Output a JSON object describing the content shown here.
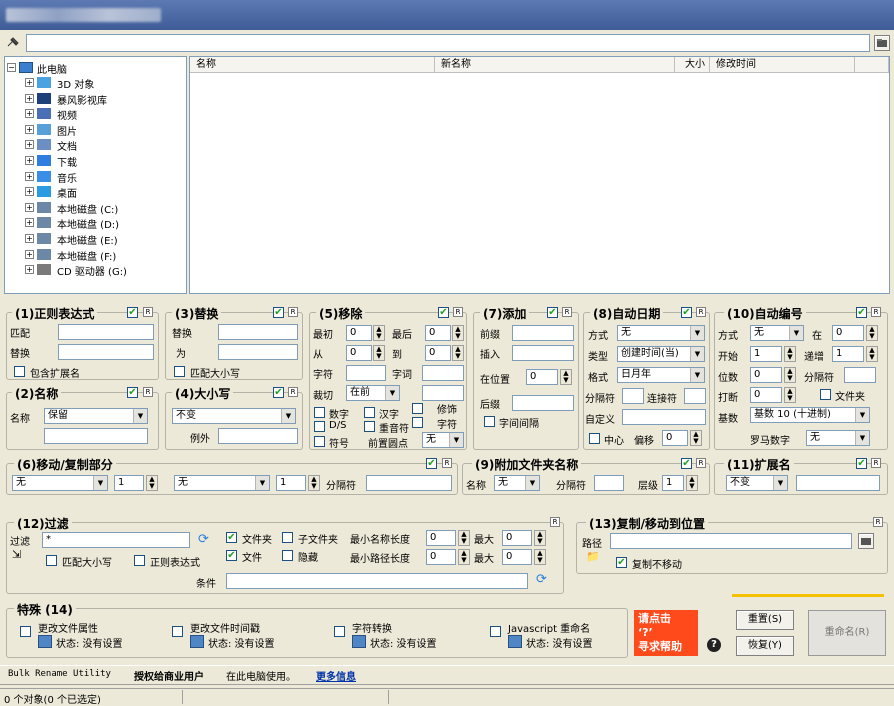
{
  "path": {
    "value": ""
  },
  "tree": {
    "root": "此电脑",
    "items": [
      "3D 对象",
      "暴风影视库",
      "视频",
      "图片",
      "文档",
      "下载",
      "音乐",
      "桌面",
      "本地磁盘 (C:)",
      "本地磁盘 (D:)",
      "本地磁盘 (E:)",
      "本地磁盘 (F:)",
      "CD 驱动器 (G:)"
    ]
  },
  "list": {
    "columns": [
      "名称",
      "新名称",
      "大小",
      "修改时间"
    ]
  },
  "g1": {
    "title": "(1)正则表达式",
    "match": "匹配",
    "replace": "替换",
    "include_ext": "包含扩展名"
  },
  "g2": {
    "title": "(2)名称",
    "name": "名称",
    "mode": "保留"
  },
  "g3": {
    "title": "(3)替换",
    "replace": "替换",
    "with": "为",
    "match_case": "匹配大小写"
  },
  "g4": {
    "title": "(4)大小写",
    "mode": "不变",
    "except": "例外"
  },
  "g5": {
    "title": "(5)移除",
    "first": "最初",
    "first_val": "0",
    "last": "最后",
    "last_val": "0",
    "from": "从",
    "from_val": "0",
    "to": "到",
    "to_val": "0",
    "chars": "字符",
    "words": "字词",
    "crop": "裁切",
    "crop_val": "在前",
    "digits": "数字",
    "chinese": "汉字",
    "trim": "修饰",
    "ds": "D/S",
    "accents": "重音符",
    "chars2": "字符",
    "symbols": "符号",
    "lead_dots": "前置圆点",
    "lead_dots_val": "无"
  },
  "g6": {
    "title": "(6)移动/复制部分",
    "sel1": "无",
    "num1": "1",
    "sel2": "无",
    "num2": "1",
    "sep": "分隔符"
  },
  "g7": {
    "title": "(7)添加",
    "prefix": "前缀",
    "insert": "插入",
    "at_pos": "在位置",
    "at_pos_val": "0",
    "suffix": "后缀",
    "word_space": "字间间隔"
  },
  "g8": {
    "title": "(8)自动日期",
    "mode": "方式",
    "mode_val": "无",
    "type": "类型",
    "type_val": "创建时间(当)",
    "format": "格式",
    "format_val": "日月年",
    "sep": "分隔符",
    "joiner": "连接符",
    "custom": "自定义",
    "center": "中心",
    "offset": "偏移",
    "offset_val": "0"
  },
  "g9": {
    "title": "(9)附加文件夹名称",
    "name": "名称",
    "name_val": "无",
    "sep": "分隔符",
    "level": "层级",
    "level_val": "1"
  },
  "g10": {
    "title": "(10)自动编号",
    "mode": "方式",
    "mode_val": "无",
    "at": "在",
    "at_val": "0",
    "start": "开始",
    "start_val": "1",
    "step": "递增",
    "step_val": "1",
    "digits": "位数",
    "digits_val": "0",
    "sep": "分隔符",
    "break": "打断",
    "break_val": "0",
    "folder": "文件夹",
    "base": "基数",
    "base_val": "基数 10 (十进制)",
    "roman": "罗马数字",
    "roman_val": "无"
  },
  "g11": {
    "title": "(11)扩展名",
    "mode": "不变"
  },
  "g12": {
    "title": "(12)过滤",
    "filter": "过滤",
    "filter_val": "*",
    "match_case": "匹配大小写",
    "regex": "正则表达式",
    "folders": "文件夹",
    "subfolders": "子文件夹",
    "files": "文件",
    "hidden": "隐藏",
    "min_name": "最小名称长度",
    "min_name_val": "0",
    "max_name": "最大",
    "max_name_val": "0",
    "min_path": "最小路径长度",
    "min_path_val": "0",
    "max_path": "最大",
    "max_path_val": "0",
    "condition": "条件"
  },
  "g13": {
    "title": "(13)复制/移动到位置",
    "path": "路径",
    "copy_not_move": "复制不移动"
  },
  "g14": {
    "title": "特殊 (14)",
    "items": [
      {
        "label": "更改文件属性",
        "status": "状态: 没有设置"
      },
      {
        "label": "更改文件时间戳",
        "status": "状态: 没有设置"
      },
      {
        "label": "字符转换",
        "status": "状态: 没有设置"
      },
      {
        "label": "Javascript 重命名",
        "status": "状态: 没有设置"
      }
    ]
  },
  "help": {
    "line1": "请点击",
    "line2": "‘?’",
    "line3": "寻求帮助"
  },
  "buttons": {
    "reset": "重置(S)",
    "revert": "恢复(Y)",
    "rename": "重命名(R)"
  },
  "footer": {
    "app": "Bulk Rename Utility",
    "licensed": "授权给商业用户",
    "rest": "在此电脑使用。",
    "more": "更多信息"
  },
  "status": {
    "text": "0 个对象(0 个已选定)"
  },
  "r_label": "R"
}
